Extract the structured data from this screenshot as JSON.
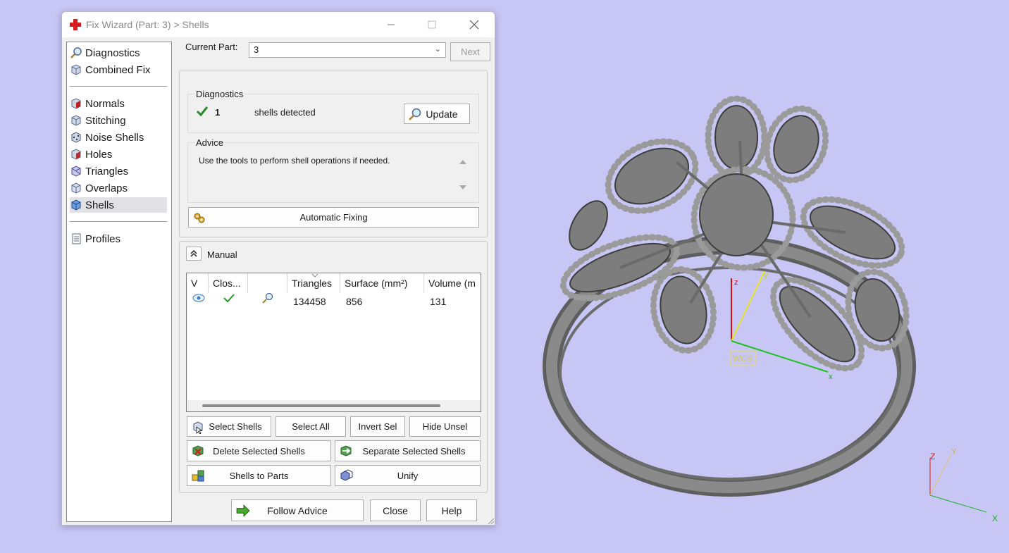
{
  "window": {
    "title": "Fix Wizard (Part: 3) > Shells"
  },
  "sidebar": {
    "items": [
      {
        "label": "Diagnostics",
        "icon": "magnifier-icon"
      },
      {
        "label": "Combined Fix",
        "icon": "cube-icon"
      },
      {
        "label": "Normals",
        "icon": "normals-cube-icon"
      },
      {
        "label": "Stitching",
        "icon": "stitching-cube-icon"
      },
      {
        "label": "Noise Shells",
        "icon": "noise-shells-icon"
      },
      {
        "label": "Holes",
        "icon": "holes-cube-icon"
      },
      {
        "label": "Triangles",
        "icon": "triangles-cube-icon"
      },
      {
        "label": "Overlaps",
        "icon": "overlaps-cube-icon"
      },
      {
        "label": "Shells",
        "icon": "shells-cube-icon",
        "selected": true
      },
      {
        "label": "Profiles",
        "icon": "document-icon"
      }
    ]
  },
  "current_part": {
    "label": "Current Part:",
    "value": "3",
    "next_label": "Next"
  },
  "diagnostics": {
    "title": "Diagnostics",
    "count": "1",
    "status_text": "shells detected",
    "update_label": "Update"
  },
  "advice": {
    "title": "Advice",
    "text": "Use the tools to perform shell operations if needed."
  },
  "automatic_fixing_label": "Automatic Fixing",
  "manual": {
    "title": "Manual",
    "columns": [
      "V",
      "Clos...",
      "",
      "Triangles",
      "Surface (mm²)",
      "Volume (m"
    ],
    "rows": [
      {
        "triangles": "134458",
        "surface": "856",
        "volume": "131"
      }
    ],
    "buttons": {
      "select_shells": "Select Shells",
      "select_all": "Select All",
      "invert_sel": "Invert Sel",
      "hide_unsel": "Hide Unsel",
      "delete_selected": "Delete Selected Shells",
      "separate_selected": "Separate Selected Shells",
      "shells_to_parts": "Shells to Parts",
      "unify": "Unify"
    }
  },
  "footer": {
    "follow_advice": "Follow Advice",
    "close": "Close",
    "help": "Help"
  },
  "viewport": {
    "wcs_label": "WCS",
    "axis_x": "x",
    "axis_y": "y",
    "axis_z": "z",
    "corner_x": "X",
    "corner_y": "Y",
    "corner_z": "Z",
    "background_color": "#c8c6f5"
  }
}
